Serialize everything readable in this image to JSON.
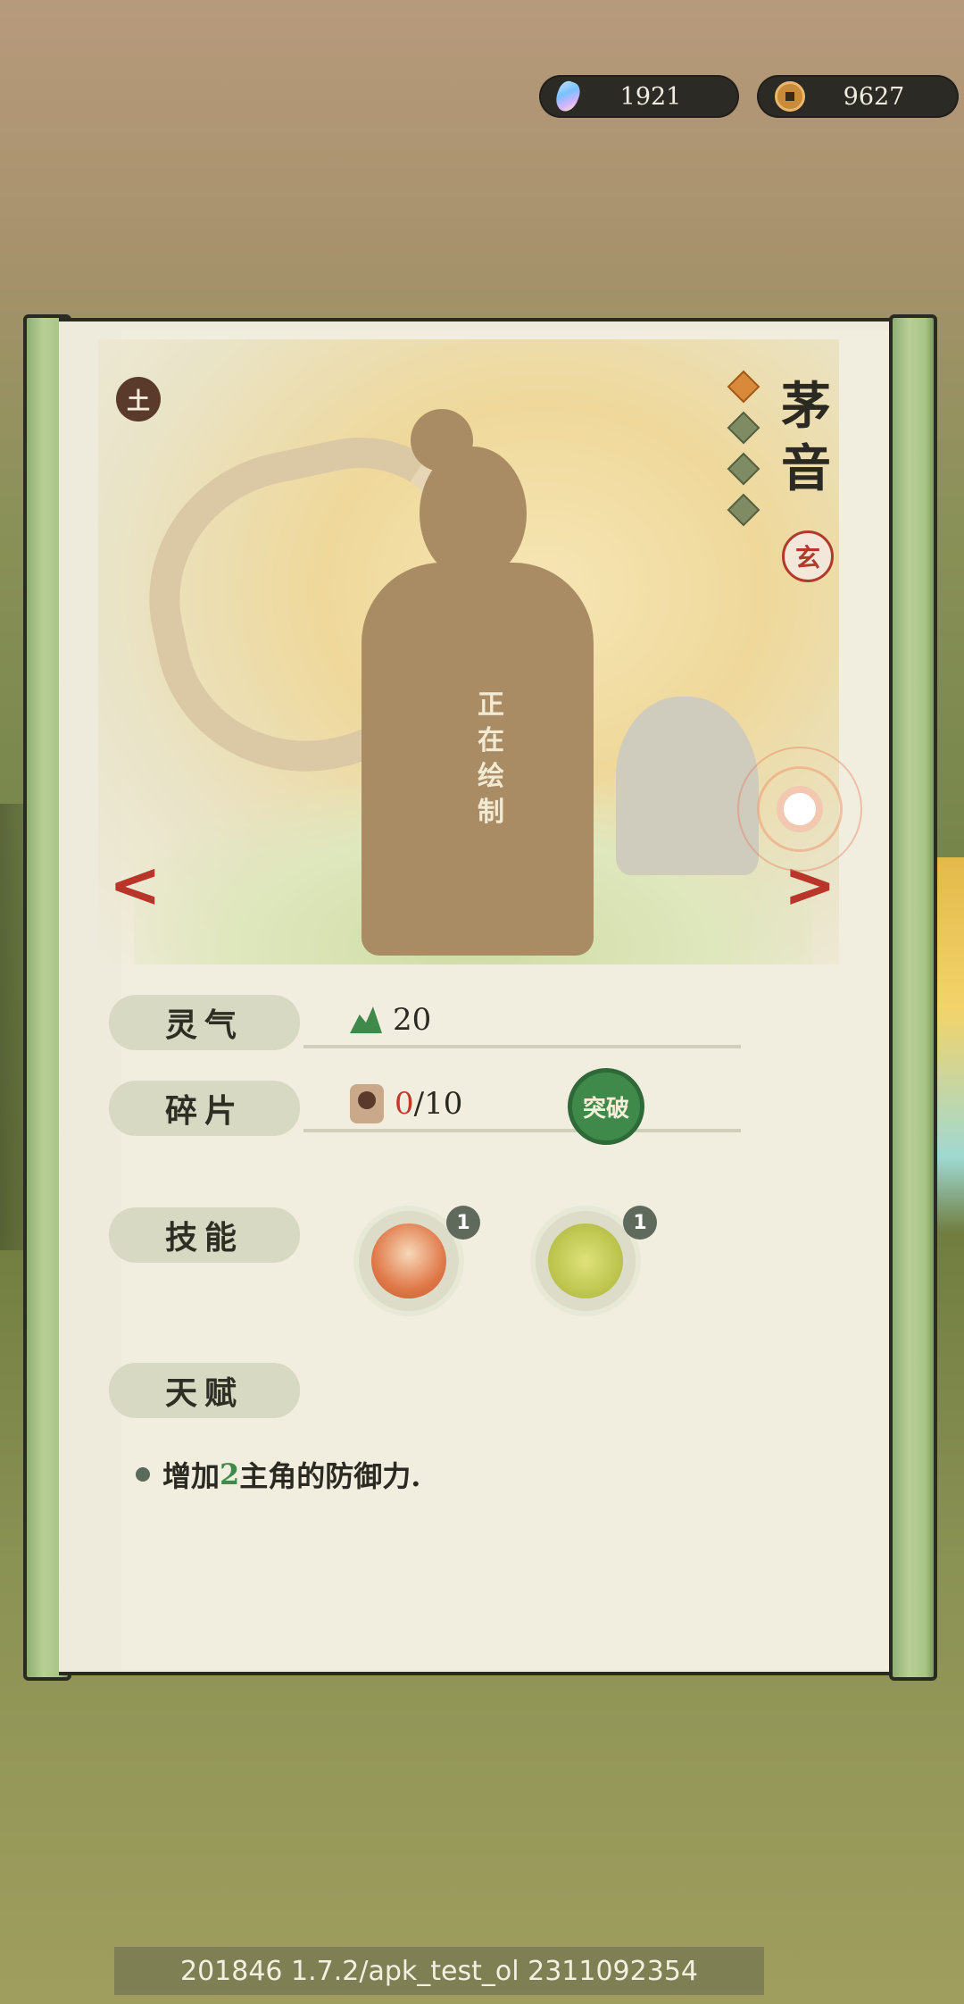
{
  "currency": {
    "gems": {
      "icon": "gem-icon",
      "value": "1921"
    },
    "coins": {
      "icon": "coin-icon",
      "value": "9627"
    }
  },
  "character": {
    "element": "土",
    "name": "茅音",
    "star_count": 4,
    "stars_lit": 1,
    "grade_seal": "玄",
    "portrait_placeholder": "正在绘制"
  },
  "stats": {
    "spirit_label": "灵气",
    "spirit_value": "20",
    "fragment_label": "碎片",
    "fragment_have": "0",
    "fragment_need": "/10",
    "breakthrough_label": "突破",
    "skill_label": "技能",
    "skills": [
      {
        "icon": "girl-portrait-skill-icon",
        "level": "1"
      },
      {
        "icon": "hoe-field-skill-icon",
        "level": "1"
      }
    ],
    "talent_label": "天赋",
    "talent_prefix": "增加",
    "talent_amount": "2",
    "talent_suffix": "主角的防御力."
  },
  "build_info": "201846  1.7.2/apk_test_ol  2311092354",
  "colors": {
    "accent_green": "#3f8a4a",
    "accent_red": "#c2392b",
    "star_lit": "#d88a3a"
  }
}
